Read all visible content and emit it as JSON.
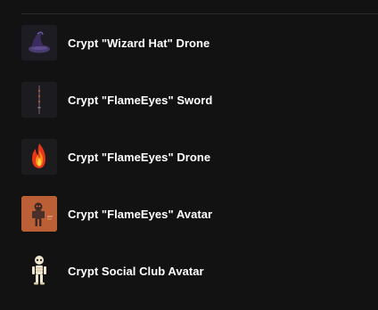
{
  "items": [
    {
      "label": "Crypt \"Wizard Hat\" Drone",
      "icon": "wizard-hat-icon",
      "thumb_bg": "#1c1c22"
    },
    {
      "label": "Crypt \"FlameEyes\" Sword",
      "icon": "sword-icon",
      "thumb_bg": "#1c1c20"
    },
    {
      "label": "Crypt \"FlameEyes\" Drone",
      "icon": "flame-icon",
      "thumb_bg": "#1c1c1e"
    },
    {
      "label": "Crypt \"FlameEyes\" Avatar",
      "icon": "avatar-icon",
      "thumb_bg": "#c0653a"
    },
    {
      "label": "Crypt Social Club Avatar",
      "icon": "skeleton-icon",
      "thumb_bg": "#121212"
    }
  ]
}
